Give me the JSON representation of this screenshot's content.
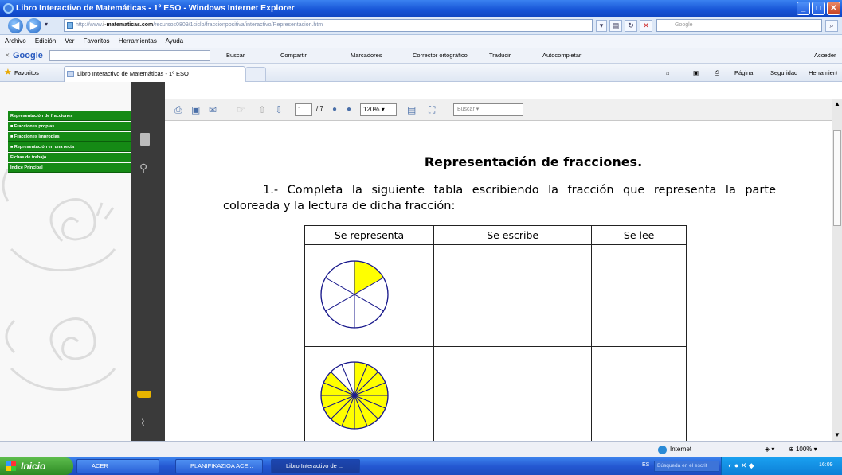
{
  "window": {
    "title": "Libro Interactivo de Matemáticas - 1º ESO - Windows Internet Explorer",
    "min": "_",
    "max": "□",
    "close": "✕"
  },
  "address": {
    "url_prefix": "http://www.",
    "url_domain": "i-matematicas.com",
    "url_path": "/recursos0809/1ciclo/fraccionpositiva/interactivo/Representacion.htm",
    "search_placeholder": "Google"
  },
  "menu": [
    "Archivo",
    "Edición",
    "Ver",
    "Favoritos",
    "Herramientas",
    "Ayuda"
  ],
  "google_toolbar": {
    "logo": "Google",
    "buscar": "Buscar",
    "compartir": "Compartir",
    "marcadores": "Marcadores",
    "corrector": "Corrector ortográfico",
    "traducir": "Traducir",
    "autocompletar": "Autocompletar",
    "acceder": "Acceder"
  },
  "favbar": {
    "favoritos": "Favoritos",
    "tab_title": "Libro Interactivo de Matemáticas - 1º ESO",
    "pagina": "Página",
    "seguridad": "Seguridad",
    "herramientas": "Herramientas"
  },
  "sidebar": {
    "items": [
      "Representación de fracciones",
      "Fracciones propias",
      "Fracciones impropias",
      "Representación en una recta",
      "Fichas de trabajo",
      "Indice Principal"
    ]
  },
  "pdf_toolbar": {
    "page": "1",
    "page_total": "/ 7",
    "zoom": "120%",
    "search_placeholder": "Buscar"
  },
  "document": {
    "title": "Representación de fracciones.",
    "instruction": "1.- Completa la siguiente tabla escribiendo la fracción que representa la parte coloreada y la lectura de dicha fracción:",
    "table_headers": [
      "Se representa",
      "Se escribe",
      "Se lee"
    ],
    "rows": [
      {
        "divisions": 6,
        "colored": 1,
        "color": "#FFFF00"
      },
      {
        "divisions": 16,
        "colored": 14,
        "color": "#FFFF00"
      }
    ]
  },
  "status": {
    "zone": "Internet",
    "zoom": "100%"
  },
  "taskbar": {
    "start": "Inicio",
    "tasks": [
      "ACER",
      "PLANIFIKAZIOA ACE...",
      "Libro Interactivo de ..."
    ],
    "lang": "ES",
    "search_placeholder": "Búsqueda en el escrit",
    "clock": "16:09"
  },
  "colors": {
    "title_blue": "#1653d6",
    "sidebar_green": "#158a15",
    "fraction_fill": "#FFFF00",
    "circle_stroke": "#1a1a8c"
  }
}
